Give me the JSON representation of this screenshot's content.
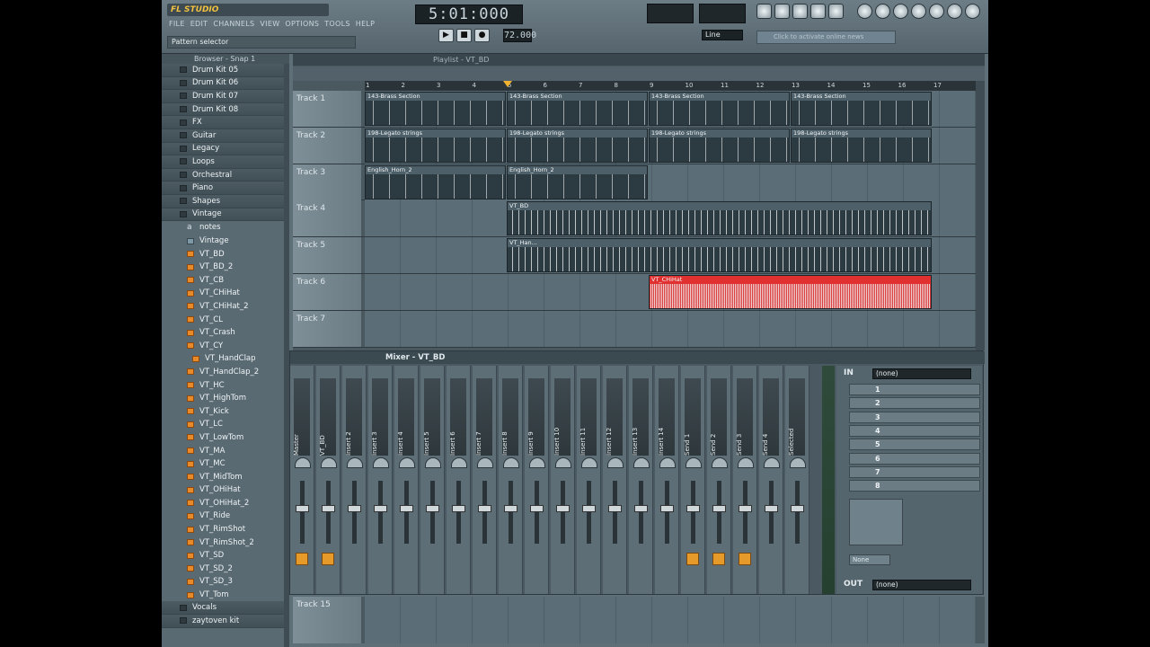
{
  "app": {
    "logo": "FL STUDIO"
  },
  "menu": [
    "FILE",
    "EDIT",
    "CHANNELS",
    "VIEW",
    "OPTIONS",
    "TOOLS",
    "HELP"
  ],
  "pattern_selector": "Pattern selector",
  "transport": {
    "time": "5:01:000",
    "tempo": "72.000",
    "snap": "Line"
  },
  "hint_text": "Click to activate online news",
  "browser": {
    "title": "Browser - Snap 1",
    "items": [
      {
        "label": "Drum Kit 05",
        "type": "folder"
      },
      {
        "label": "Drum Kit 06",
        "type": "folder"
      },
      {
        "label": "Drum Kit 07",
        "type": "folder"
      },
      {
        "label": "Drum Kit 08",
        "type": "folder"
      },
      {
        "label": "FX",
        "type": "folder"
      },
      {
        "label": "Guitar",
        "type": "folder"
      },
      {
        "label": "Legacy",
        "type": "folder"
      },
      {
        "label": "Loops",
        "type": "folder"
      },
      {
        "label": "Orchestral",
        "type": "folder"
      },
      {
        "label": "Piano",
        "type": "folder"
      },
      {
        "label": "Shapes",
        "type": "folder"
      },
      {
        "label": "Vintage",
        "type": "folder"
      },
      {
        "label": "notes",
        "type": "text"
      },
      {
        "label": "Vintage",
        "type": "flp"
      },
      {
        "label": "VT_BD",
        "type": "wav"
      },
      {
        "label": "VT_BD_2",
        "type": "wav"
      },
      {
        "label": "VT_CB",
        "type": "wav"
      },
      {
        "label": "VT_CHiHat",
        "type": "wav"
      },
      {
        "label": "VT_CHiHat_2",
        "type": "wav"
      },
      {
        "label": "VT_CL",
        "type": "wav"
      },
      {
        "label": "VT_Crash",
        "type": "wav"
      },
      {
        "label": "VT_CY",
        "type": "wav"
      },
      {
        "label": "VT_HandClap",
        "type": "wav"
      },
      {
        "label": "VT_HandClap_2",
        "type": "wav"
      },
      {
        "label": "VT_HC",
        "type": "wav"
      },
      {
        "label": "VT_HighTom",
        "type": "wav"
      },
      {
        "label": "VT_Kick",
        "type": "wav"
      },
      {
        "label": "VT_LC",
        "type": "wav"
      },
      {
        "label": "VT_LowTom",
        "type": "wav"
      },
      {
        "label": "VT_MA",
        "type": "wav"
      },
      {
        "label": "VT_MC",
        "type": "wav"
      },
      {
        "label": "VT_MidTom",
        "type": "wav"
      },
      {
        "label": "VT_OHiHat",
        "type": "wav"
      },
      {
        "label": "VT_OHiHat_2",
        "type": "wav"
      },
      {
        "label": "VT_Ride",
        "type": "wav"
      },
      {
        "label": "VT_RimShot",
        "type": "wav"
      },
      {
        "label": "VT_RimShot_2",
        "type": "wav"
      },
      {
        "label": "VT_SD",
        "type": "wav"
      },
      {
        "label": "VT_SD_2",
        "type": "wav"
      },
      {
        "label": "VT_SD_3",
        "type": "wav"
      },
      {
        "label": "VT_Tom",
        "type": "wav"
      },
      {
        "label": "Vocals",
        "type": "folder"
      },
      {
        "label": "zaytoven kit",
        "type": "folder"
      }
    ]
  },
  "playlist": {
    "title": "Playlist - VT_BD",
    "bars": [
      "1",
      "2",
      "3",
      "4",
      "5",
      "6",
      "7",
      "8",
      "9",
      "10",
      "11",
      "12",
      "13",
      "14",
      "15",
      "16",
      "17"
    ],
    "tracks": [
      {
        "name": "Track 1",
        "clips": [
          {
            "label": "143-Brass Section",
            "start": 0,
            "bars": 4
          },
          {
            "label": "143-Brass Section",
            "start": 4,
            "bars": 4
          },
          {
            "label": "143-Brass Section",
            "start": 8,
            "bars": 4
          },
          {
            "label": "143-Brass Section",
            "start": 12,
            "bars": 4
          }
        ]
      },
      {
        "name": "Track 2",
        "clips": [
          {
            "label": "198-Legato strings",
            "start": 0,
            "bars": 4
          },
          {
            "label": "198-Legato strings",
            "start": 4,
            "bars": 4
          },
          {
            "label": "198-Legato strings",
            "start": 8,
            "bars": 4
          },
          {
            "label": "198-Legato strings",
            "start": 12,
            "bars": 4
          }
        ]
      },
      {
        "name": "Track 3",
        "clips": [
          {
            "label": "English_Horn_2",
            "start": 0,
            "bars": 4
          },
          {
            "label": "English_Horn_2",
            "start": 4,
            "bars": 4
          }
        ]
      },
      {
        "name": "Track 4",
        "clips": [
          {
            "label": "VT_BD",
            "start": 4,
            "bars": 12,
            "slim": true
          }
        ]
      },
      {
        "name": "Track 5",
        "clips": [
          {
            "label": "VT_Han...",
            "start": 4,
            "bars": 12,
            "slim": true
          }
        ]
      },
      {
        "name": "Track 6",
        "clips": [
          {
            "label": "VT_CHiHat",
            "start": 8,
            "bars": 8,
            "red": true
          }
        ]
      },
      {
        "name": "Track 7",
        "clips": []
      }
    ],
    "bottom_track": "Track 15"
  },
  "mixer": {
    "title": "Mixer - VT_BD",
    "strips": [
      "Master",
      "VT_BD",
      "Insert 2",
      "Insert 3",
      "Insert 4",
      "Insert 5",
      "Insert 6",
      "Insert 7",
      "Insert 8",
      "Insert 9",
      "Insert 10",
      "Insert 11",
      "Insert 12",
      "Insert 13",
      "Insert 14",
      "Send 1",
      "Send 2",
      "Send 3",
      "Send 4",
      "Selected"
    ],
    "in_label": "IN",
    "in_value": "(none)",
    "fx_slots": [
      "1",
      "2",
      "3",
      "4",
      "5",
      "6",
      "7",
      "8"
    ],
    "out_label": "OUT",
    "out_value": "(none)",
    "eq_preset": "None"
  },
  "colors": {
    "accent": "#e59a2a",
    "clip_red": "#bd1c1c"
  }
}
